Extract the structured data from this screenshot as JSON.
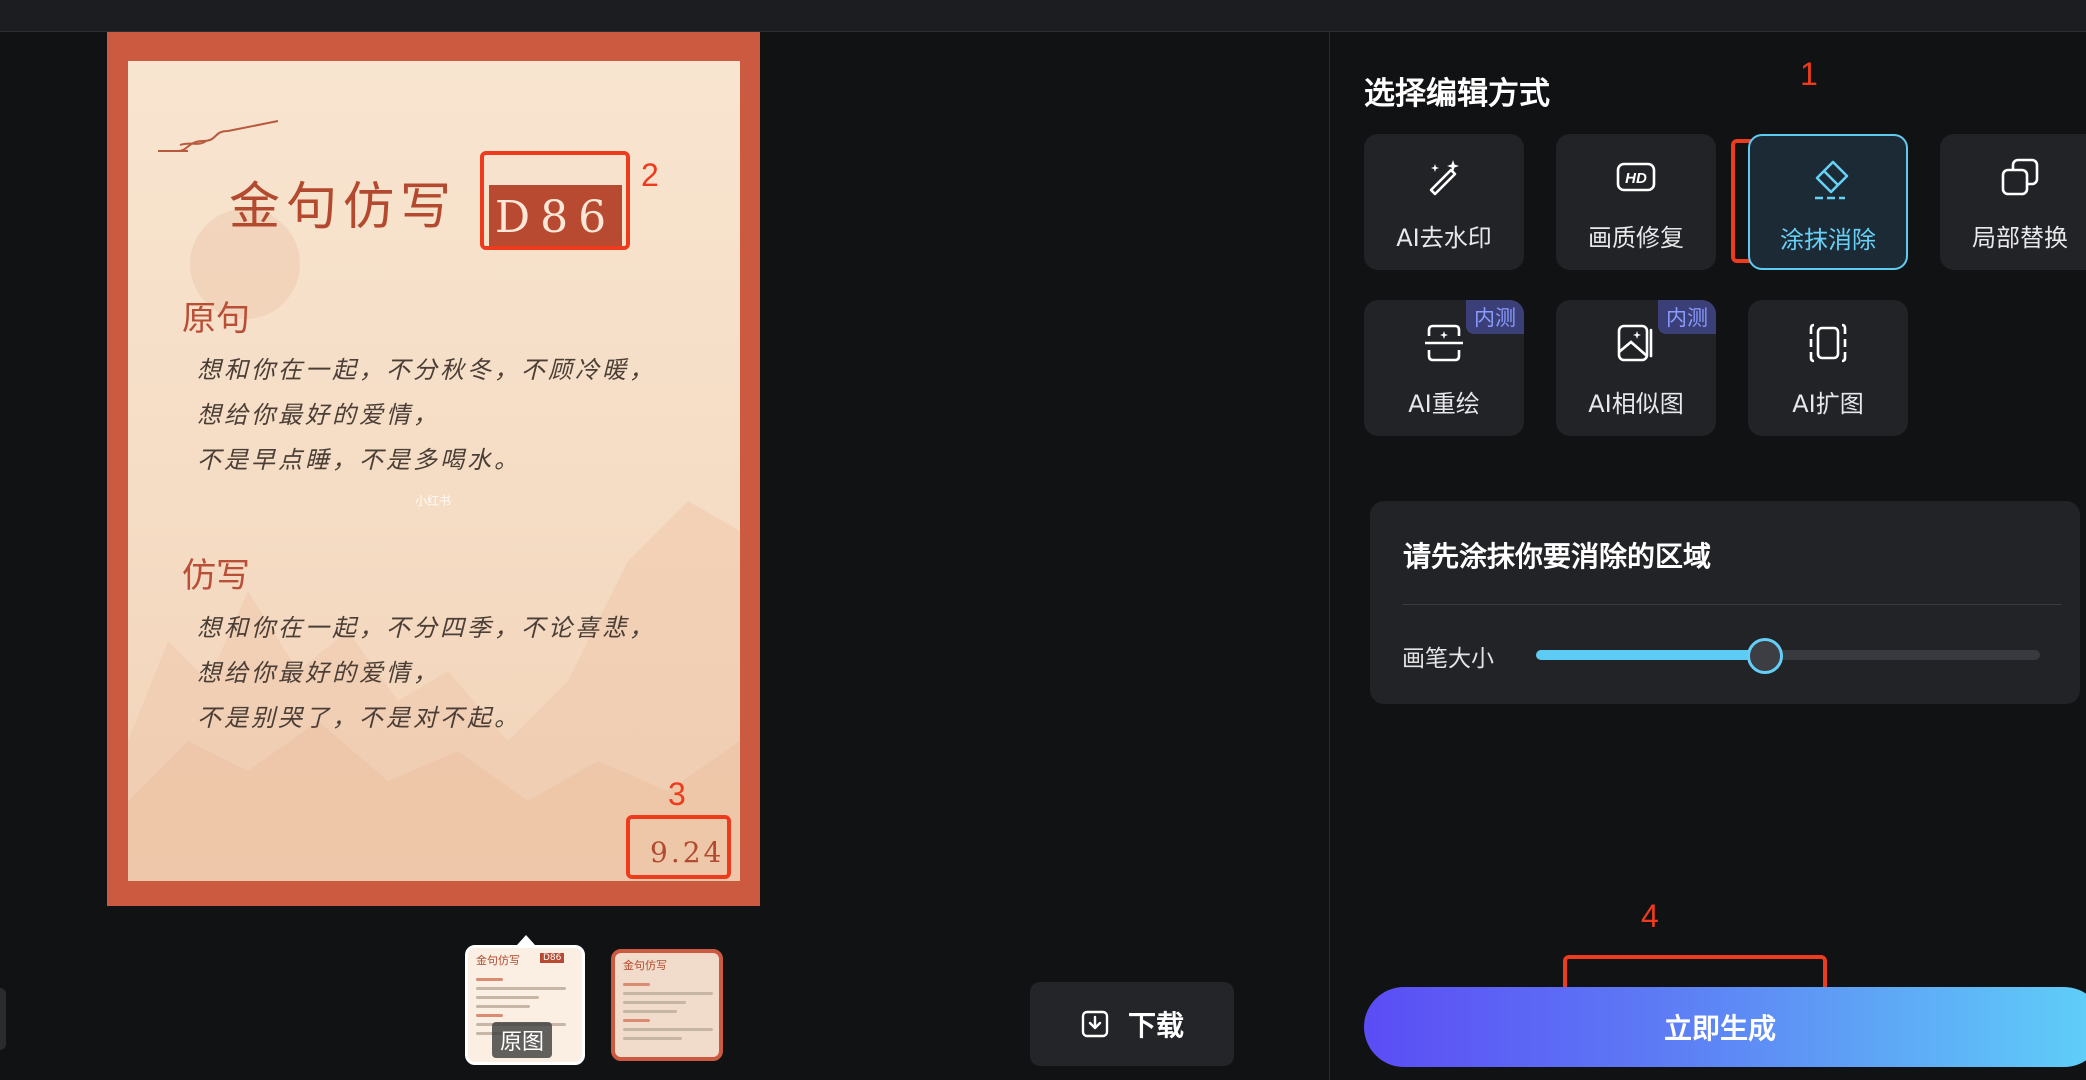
{
  "canvas": {
    "poster": {
      "title": "金句仿写",
      "code": "D86",
      "original_heading": "原句",
      "original_lines": [
        "想和你在一起，不分秋冬，不顾冷暖，",
        "想给你最好的爱情，",
        "不是早点睡，不是多喝水。"
      ],
      "rewrite_heading": "仿写",
      "rewrite_lines": [
        "想和你在一起，不分四季，不论喜悲，",
        "想给你最好的爱情，",
        "不是别哭了，不是对不起。"
      ],
      "date": "9.24",
      "watermark": "小红书"
    },
    "annotations": [
      "1",
      "2",
      "3",
      "4"
    ],
    "thumbnails": {
      "original_label": "原图",
      "thumb_title": "金句仿写",
      "thumb_tag": "D86"
    },
    "download_label": "下载"
  },
  "panel": {
    "title": "选择编辑方式",
    "tools": [
      {
        "label": "AI去水印",
        "icon": "magic-wand-icon"
      },
      {
        "label": "画质修复",
        "icon": "hd-icon"
      },
      {
        "label": "涂抹消除",
        "icon": "eraser-icon",
        "active": true
      },
      {
        "label": "局部替换",
        "icon": "replace-icon"
      },
      {
        "label": "AI重绘",
        "icon": "redraw-icon",
        "badge": "内测"
      },
      {
        "label": "AI相似图",
        "icon": "similar-image-icon",
        "badge": "内测"
      },
      {
        "label": "AI扩图",
        "icon": "expand-icon"
      }
    ],
    "erase_section": {
      "title": "请先涂抹你要消除的区域",
      "brush_label": "画笔大小",
      "brush_size": 0.45
    },
    "generate_label": "立即生成"
  },
  "colors": {
    "accent": "#5fcbf0",
    "annotation": "#ee3b1e",
    "poster_frame": "#cc5a40",
    "badge_text": "#8b9bff"
  }
}
